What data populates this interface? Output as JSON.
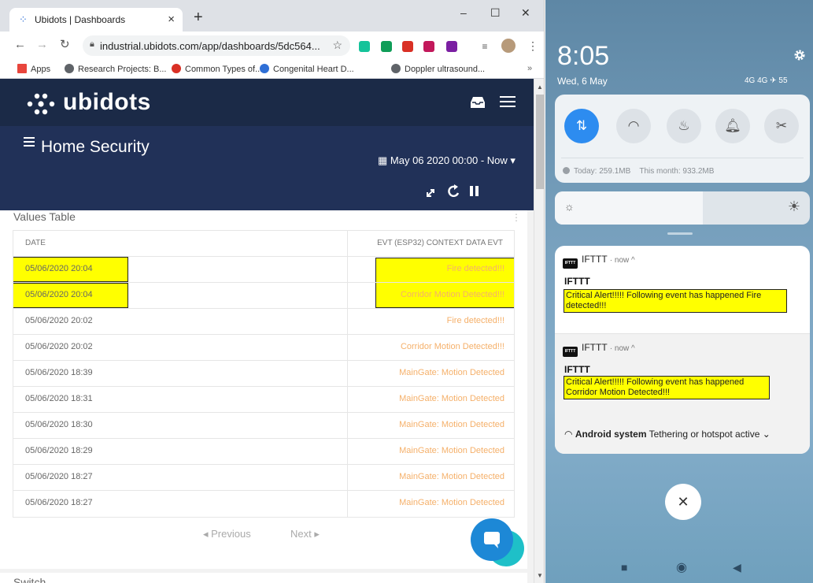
{
  "browser": {
    "tab_title": "Ubidots | Dashboards",
    "tab_close": "×",
    "new_tab": "+",
    "window_controls": {
      "minimize": "–",
      "maximize": "☐",
      "close": "✕"
    },
    "url": "industrial.ubidots.com/app/dashboards/5dc564...",
    "bookmarks": [
      {
        "label": "Apps",
        "color": "#e8453c"
      },
      {
        "label": "Research Projects: B...",
        "color": "#5f6368"
      },
      {
        "label": "Common Types of...",
        "color": "#d93025"
      },
      {
        "label": "Congenital Heart D...",
        "color": "#2f6fd6"
      },
      {
        "label": "Doppler ultrasound...",
        "color": "#5f6368"
      }
    ],
    "bookmarks_more": "»",
    "extensions": [
      {
        "name": "grammarly-icon",
        "color": "#15c39a"
      },
      {
        "name": "extension-green-icon",
        "color": "#0f9d58"
      },
      {
        "name": "extension-red-icon",
        "color": "#d93025"
      },
      {
        "name": "extension-pink-icon",
        "color": "#c2185b"
      },
      {
        "name": "extension-purple-icon",
        "color": "#7b1fa2"
      },
      {
        "name": "playlist-icon",
        "color": "#5f6368"
      }
    ]
  },
  "ubidots": {
    "logo": "ubidots",
    "dashboard_title": "Home Security",
    "date_range": "May 06 2020 00:00 - Now",
    "widget": {
      "title": "Values Table",
      "col_date": "DATE",
      "col_value": "EVT (ESP32) CONTEXT DATA EVT",
      "rows": [
        {
          "date": "05/06/2020 20:04",
          "value": "Fire detected!!!"
        },
        {
          "date": "05/06/2020 20:04",
          "value": "Corridor Motion Detected!!!"
        },
        {
          "date": "05/06/2020 20:02",
          "value": "Fire detected!!!"
        },
        {
          "date": "05/06/2020 20:02",
          "value": "Corridor Motion Detected!!!"
        },
        {
          "date": "05/06/2020 18:39",
          "value": "MainGate: Motion Detected"
        },
        {
          "date": "05/06/2020 18:31",
          "value": "MainGate: Motion Detected"
        },
        {
          "date": "05/06/2020 18:30",
          "value": "MainGate: Motion Detected"
        },
        {
          "date": "05/06/2020 18:29",
          "value": "MainGate: Motion Detected"
        },
        {
          "date": "05/06/2020 18:27",
          "value": "MainGate: Motion Detected"
        },
        {
          "date": "05/06/2020 18:27",
          "value": "MainGate: Motion Detected"
        }
      ],
      "prev": "◂ Previous",
      "next": "Next ▸"
    },
    "next_widget_title": "Switch"
  },
  "phone": {
    "time": "8:05",
    "date": "Wed, 6 May",
    "status_icons": "4G 4G ✈ 55",
    "data_usage_today": "Today: 259.1MB",
    "data_usage_month": "This month: 933.2MB",
    "brightness_level": 0.58,
    "notifications": [
      {
        "app": "IFTTT",
        "meta": "· now ^",
        "title": "IFTTT",
        "body": "Critical Alert!!!!! Following event has happened Fire detected!!!"
      },
      {
        "app": "IFTTT",
        "meta": "· now ^",
        "title": "IFTTT",
        "body": "Critical Alert!!!!! Following event has happened Corridor Motion Detected!!!"
      }
    ],
    "system_notification": {
      "app": "Android system",
      "text": "Tethering or hotspot active",
      "chevron": "⌄"
    },
    "dismiss": "✕"
  }
}
